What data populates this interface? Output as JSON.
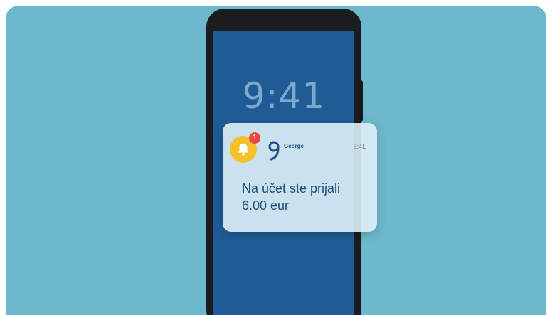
{
  "lockscreen": {
    "time": "9:41"
  },
  "notification": {
    "badge_count": "1",
    "app_name": "George",
    "time": "9:41",
    "message_line1": "Na účet ste prijali",
    "message_line2": "6.00 eur",
    "icons": [
      "bell-icon",
      "george-logo-icon"
    ]
  },
  "colors": {
    "background": "#6db8cc",
    "phone_frame": "#1a1c1f",
    "screen": "#1f5c96",
    "bell_badge": "#f3c12a",
    "count_badge": "#e8473b",
    "notification_text": "#1f4a7a"
  }
}
